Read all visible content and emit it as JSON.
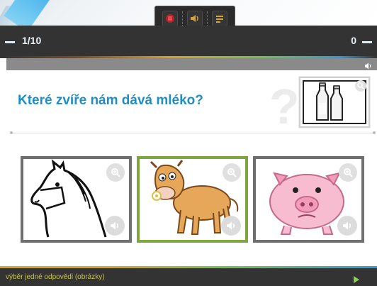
{
  "header": {
    "counter": "1/10",
    "score": "0"
  },
  "toolbar": {
    "icons": [
      "stop-icon",
      "sound-icon",
      "settings-icon"
    ]
  },
  "question": {
    "text": "Které zvíře nám dává mléko?"
  },
  "question_image": {
    "description_icon": "milk-bottles-icon"
  },
  "answers": [
    {
      "animal": "horse",
      "selected": false
    },
    {
      "animal": "cow",
      "selected": true
    },
    {
      "animal": "pig",
      "selected": false
    }
  ],
  "footer": {
    "mode_label": "výběr jedné odpovědi (obrázky)"
  },
  "colors": {
    "question": "#1f8ec6",
    "selected_border": "#7fa541",
    "footer_text": "#c7c54a",
    "header_bg": "#333333"
  }
}
